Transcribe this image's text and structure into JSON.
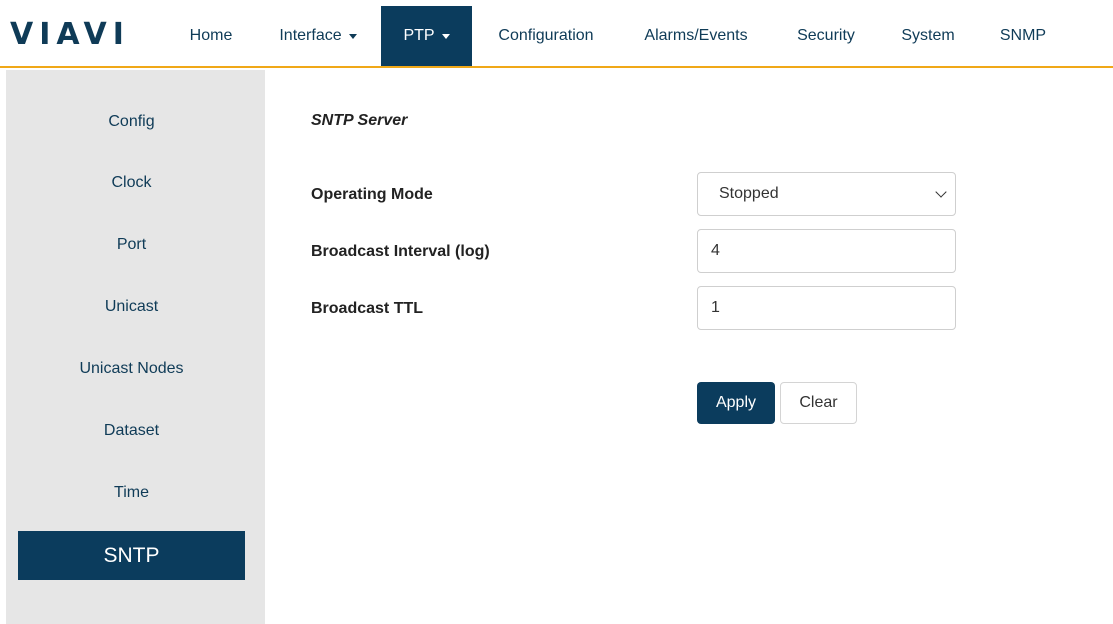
{
  "brand": {
    "logo_text": "VIAVI"
  },
  "nav": {
    "items": [
      {
        "label": "Home",
        "dropdown": false
      },
      {
        "label": "Interface",
        "dropdown": true
      },
      {
        "label": "PTP",
        "dropdown": true,
        "active": true
      },
      {
        "label": "Configuration",
        "dropdown": false
      },
      {
        "label": "Alarms/Events",
        "dropdown": false
      },
      {
        "label": "Security",
        "dropdown": false
      },
      {
        "label": "System",
        "dropdown": false
      },
      {
        "label": "SNMP",
        "dropdown": false
      }
    ]
  },
  "sidebar": {
    "items": [
      {
        "label": "Config"
      },
      {
        "label": "Clock"
      },
      {
        "label": "Port"
      },
      {
        "label": "Unicast"
      },
      {
        "label": "Unicast Nodes"
      },
      {
        "label": "Dataset"
      },
      {
        "label": "Time"
      },
      {
        "label": "SNTP",
        "active": true
      }
    ]
  },
  "form": {
    "title": "SNTP Server",
    "operating_mode": {
      "label": "Operating Mode",
      "value": "Stopped"
    },
    "broadcast_interval": {
      "label": "Broadcast Interval (log)",
      "value": "4"
    },
    "broadcast_ttl": {
      "label": "Broadcast TTL",
      "value": "1"
    },
    "apply_label": "Apply",
    "clear_label": "Clear"
  },
  "colors": {
    "brand_navy": "#0b3c5d",
    "accent_gold": "#f0a818",
    "sidebar_bg": "#e6e6e6"
  }
}
